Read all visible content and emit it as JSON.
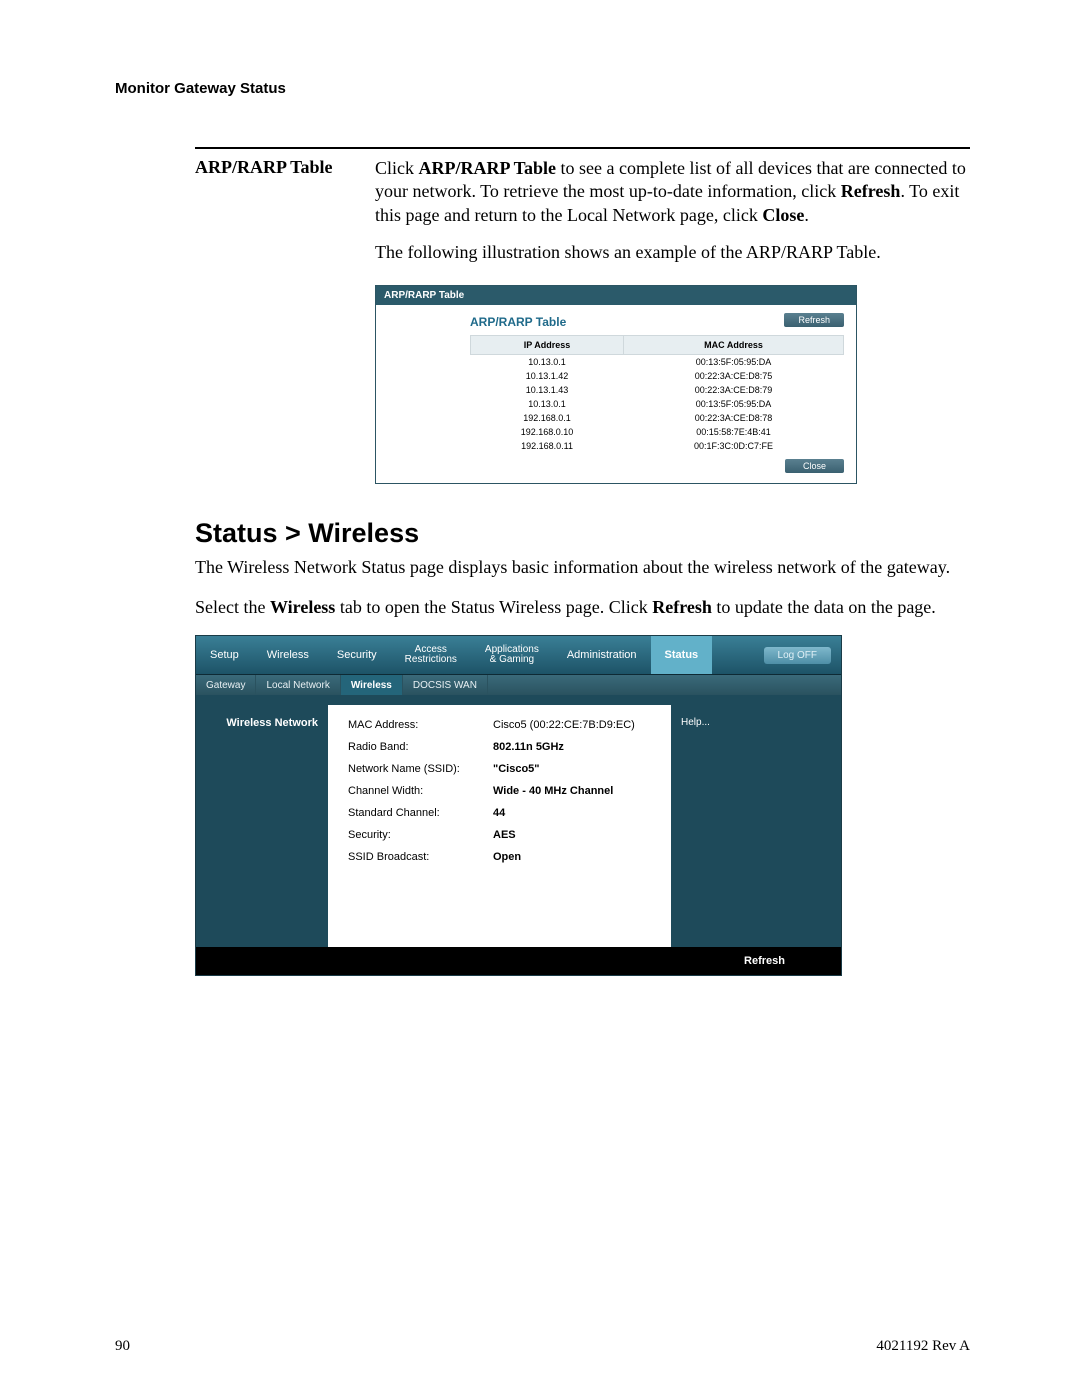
{
  "running_head": "Monitor Gateway Status",
  "arp_section": {
    "term": "ARP/RARP Table",
    "desc_parts": {
      "p1a": "Click ",
      "p1b": "ARP/RARP Table",
      "p1c": " to see a complete list of all devices that are connected to your network. To retrieve the most up-to-date information, click ",
      "p1d": "Refresh",
      "p1e": ". To exit this page and return to the Local Network page, click ",
      "p1f": "Close",
      "p1g": ".",
      "p2": "The following illustration shows an example of the ARP/RARP Table."
    }
  },
  "arp_ui": {
    "tab_label": "ARP/RARP Table",
    "title": "ARP/RARP Table",
    "refresh": "Refresh",
    "close": "Close",
    "col_ip": "IP Address",
    "col_mac": "MAC Address",
    "rows": [
      {
        "ip": "10.13.0.1",
        "mac": "00:13:5F:05:95:DA"
      },
      {
        "ip": "10.13.1.42",
        "mac": "00:22:3A:CE:D8:75"
      },
      {
        "ip": "10.13.1.43",
        "mac": "00:22:3A:CE:D8:79"
      },
      {
        "ip": "10.13.0.1",
        "mac": "00:13:5F:05:95:DA"
      },
      {
        "ip": "192.168.0.1",
        "mac": "00:22:3A:CE:D8:78"
      },
      {
        "ip": "192.168.0.10",
        "mac": "00:15:58:7E:4B:41"
      },
      {
        "ip": "192.168.0.11",
        "mac": "00:1F:3C:0D:C7:FE"
      }
    ]
  },
  "wireless_section": {
    "heading": "Status > Wireless",
    "p1": "The Wireless Network Status page displays basic information about the wireless network of the gateway.",
    "p2a": "Select the ",
    "p2b": "Wireless",
    "p2c": " tab to open the Status Wireless page. Click ",
    "p2d": "Refresh",
    "p2e": " to update the data on the page."
  },
  "router_ui": {
    "toptabs": {
      "setup": "Setup",
      "wireless": "Wireless",
      "security": "Security",
      "access1": "Access",
      "access2": "Restrictions",
      "apps1": "Applications",
      "apps2": "& Gaming",
      "admin": "Administration",
      "status": "Status",
      "logoff": "Log OFF"
    },
    "subtabs": {
      "gateway": "Gateway",
      "localnet": "Local Network",
      "wireless": "Wireless",
      "docsis": "DOCSIS WAN"
    },
    "side_label": "Wireless Network",
    "help": "Help...",
    "fields": {
      "mac_k": "MAC Address:",
      "mac_v": "Cisco5 (00:22:CE:7B:D9:EC)",
      "radio_k": "Radio Band:",
      "radio_v": "802.11n 5GHz",
      "ssid_k": "Network Name (SSID):",
      "ssid_v": "\"Cisco5\"",
      "chw_k": "Channel Width:",
      "chw_v": "Wide - 40 MHz Channel",
      "stdch_k": "Standard Channel:",
      "stdch_v": "44",
      "sec_k": "Security:",
      "sec_v": "AES",
      "bcast_k": "SSID Broadcast:",
      "bcast_v": "Open"
    },
    "refresh": "Refresh"
  },
  "footer": {
    "page_no": "90",
    "doc_id": "4021192 Rev A"
  }
}
